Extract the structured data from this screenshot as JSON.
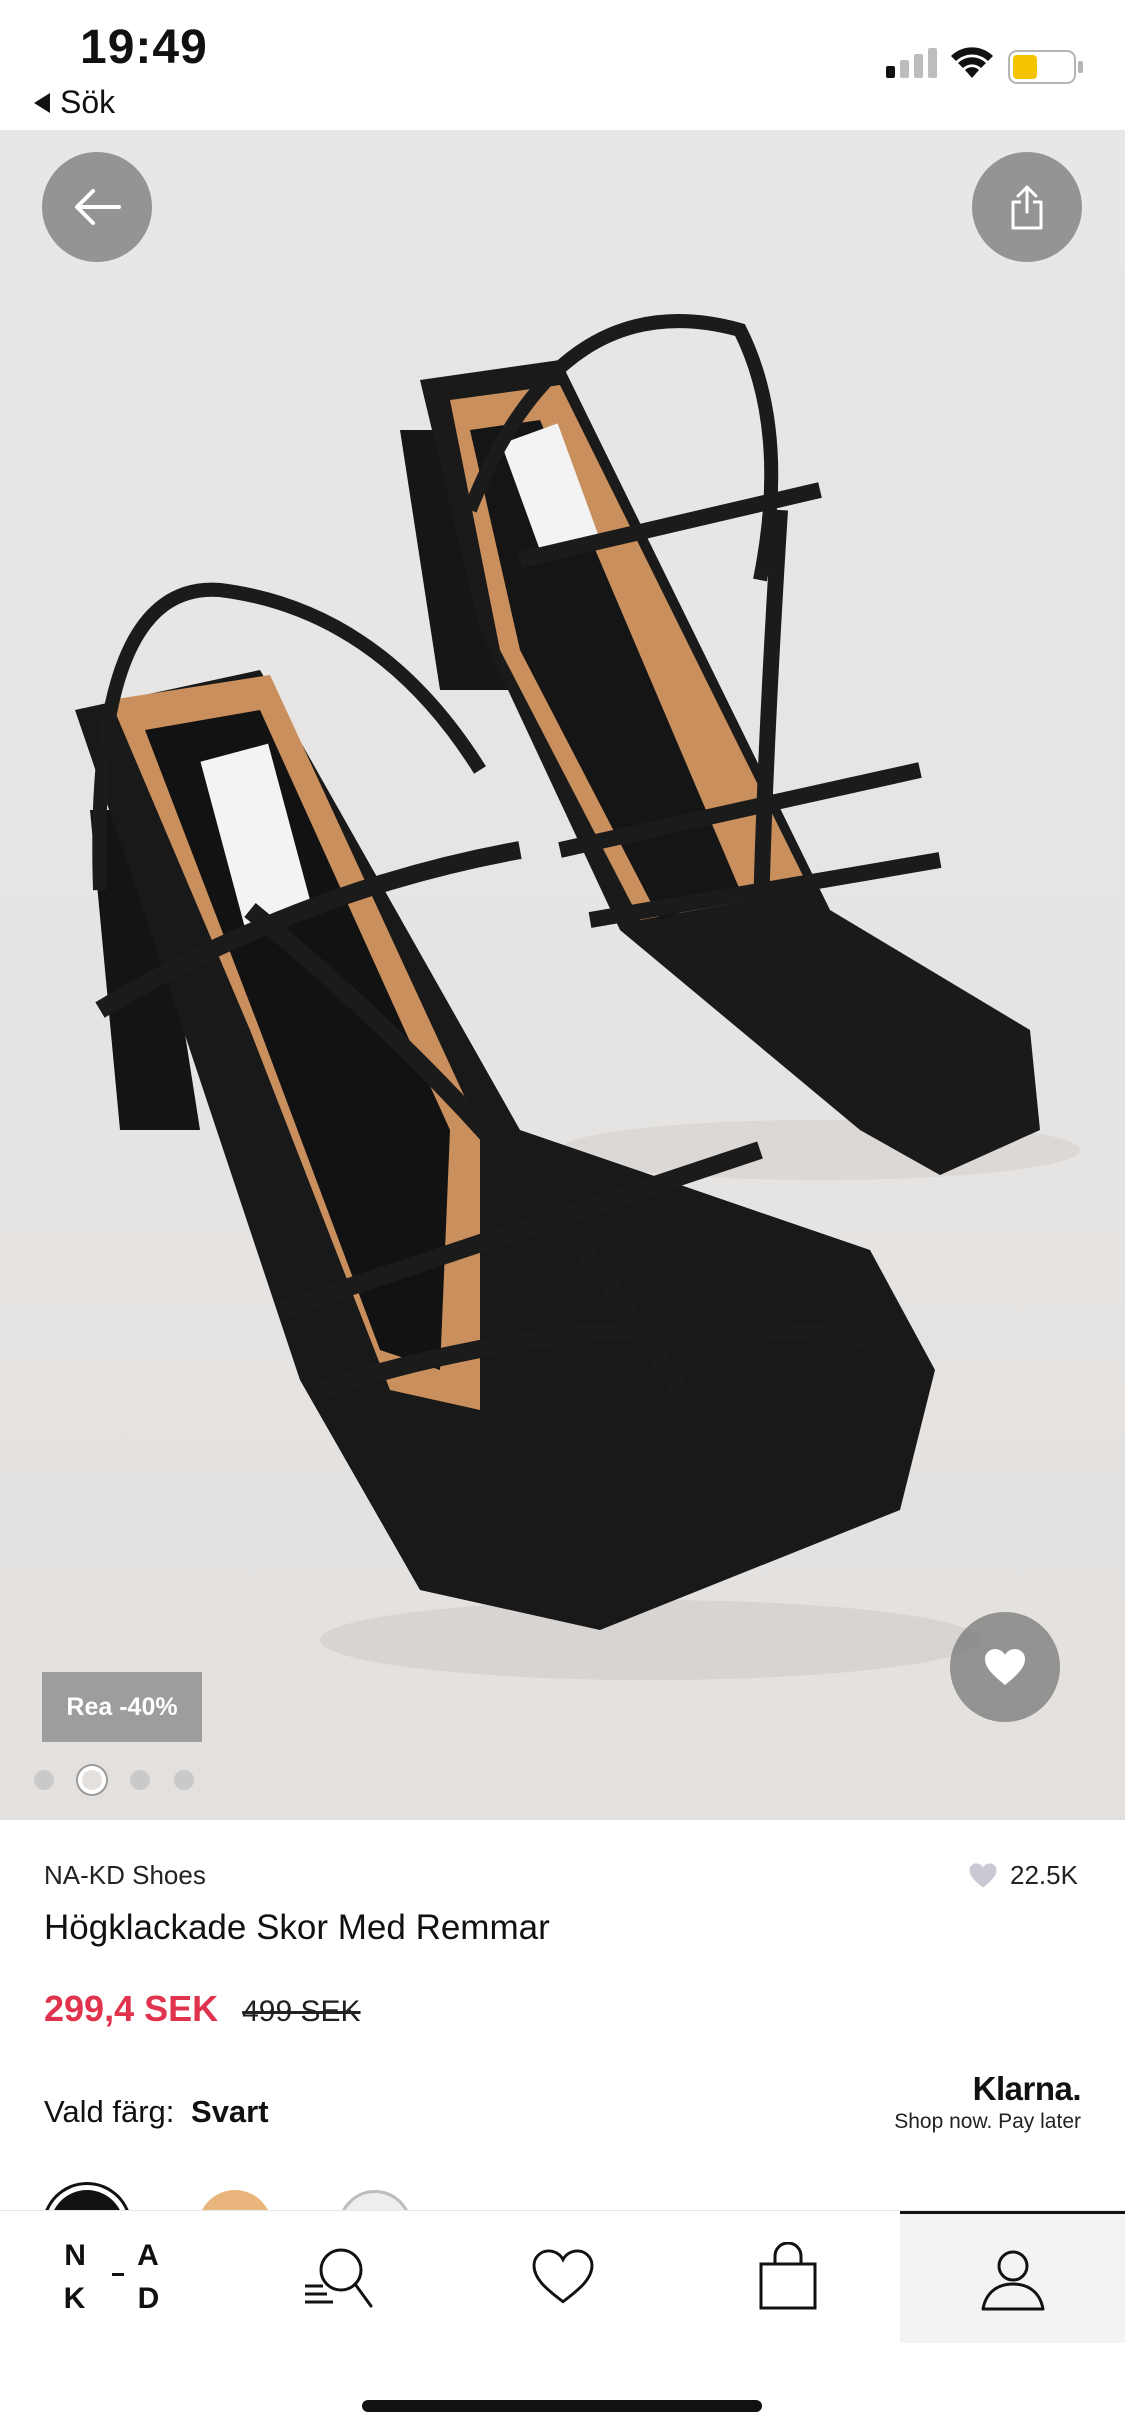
{
  "status_bar": {
    "time": "19:49",
    "back_app_label": "Sök",
    "signal_bars": 2,
    "battery_color": "#f5c400"
  },
  "hero": {
    "image_alt": "Black strappy square-toe heeled sandals",
    "sale_badge": "Rea -40%",
    "page_count": 4,
    "active_page": 2
  },
  "product": {
    "brand": "NA-KD Shoes",
    "likes": "22.5K",
    "title": "Högklackade Skor Med Remmar",
    "sale_price": "299,4 SEK",
    "original_price": "499 SEK",
    "sale_color": "#e0334d",
    "color_label": "Vald färg:",
    "color_value": "Svart"
  },
  "klarna": {
    "logo": "Klarna.",
    "tagline": "Shop now. Pay later"
  },
  "swatches": [
    "#111111",
    "#e9b57c",
    "#eeeeee"
  ],
  "tab_bar": {
    "logo_lines": [
      "N A",
      "K D"
    ],
    "tabs": [
      "home-logo",
      "search-icon",
      "heart-icon",
      "bag-icon",
      "user-icon"
    ],
    "active_tab": "user-icon"
  }
}
